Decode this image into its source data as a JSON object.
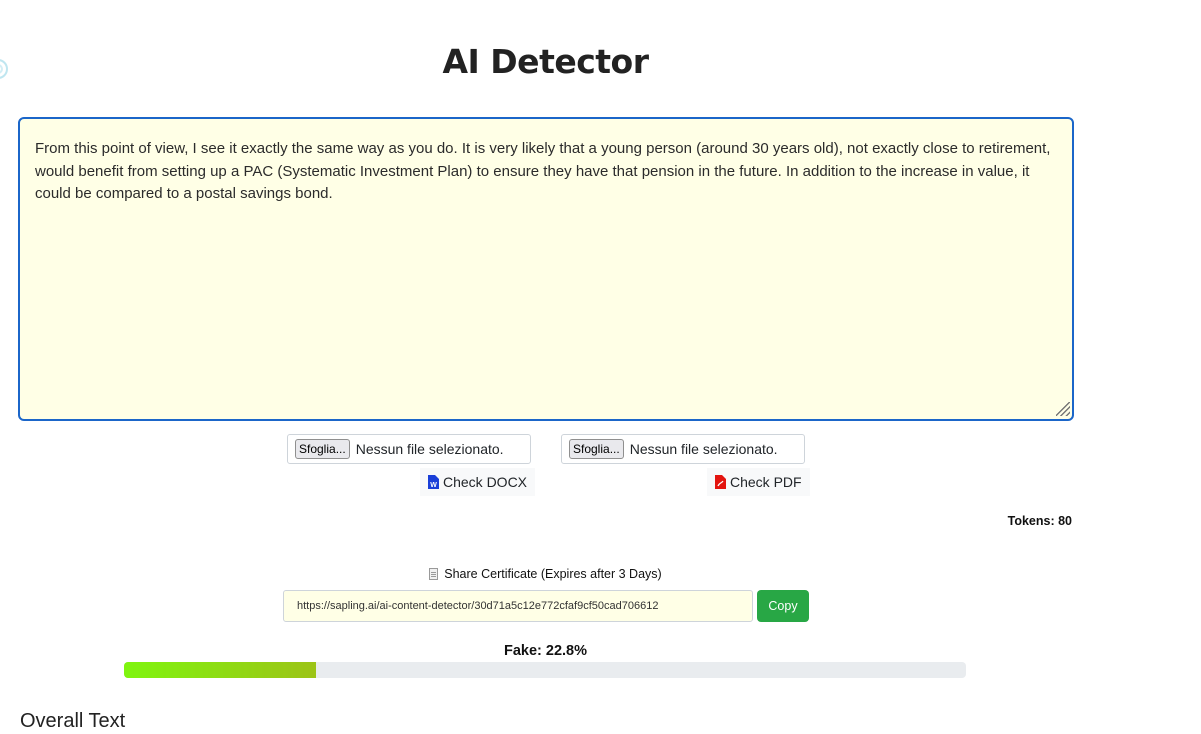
{
  "page": {
    "title": "AI Detector"
  },
  "editor": {
    "text": "From this point of view, I see it exactly the same way as you do. It is very likely that a young person (around 30 years old), not exactly close to retirement, would benefit from setting up a PAC (Systematic Investment Plan) to ensure they have that pension in the future. In addition to the increase in value, it could be compared to a postal savings bond."
  },
  "uploads": [
    {
      "browse_label": "Sfoglia...",
      "status": "Nessun file selezionato.",
      "check_label": "Check DOCX",
      "icon": "word-file-icon",
      "icon_color": "#1a3fd8"
    },
    {
      "browse_label": "Sfoglia...",
      "status": "Nessun file selezionato.",
      "check_label": "Check PDF",
      "icon": "pdf-file-icon",
      "icon_color": "#e3140f"
    }
  ],
  "tokens": {
    "label": "Tokens:",
    "value": "80"
  },
  "share": {
    "label": "Share Certificate (Expires after 3 Days)",
    "url": "https://sapling.ai/ai-content-detector/30d71a5c12e772cfaf9cf50cad706612",
    "copy_label": "Copy"
  },
  "result": {
    "label": "Fake: 22.8%",
    "fake_fraction": 0.228
  },
  "section": {
    "title": "Overall Text"
  },
  "colors": {
    "accent_border": "#1b66c9",
    "copy_button": "#28a745",
    "textarea_bg": "#ffffe6"
  }
}
